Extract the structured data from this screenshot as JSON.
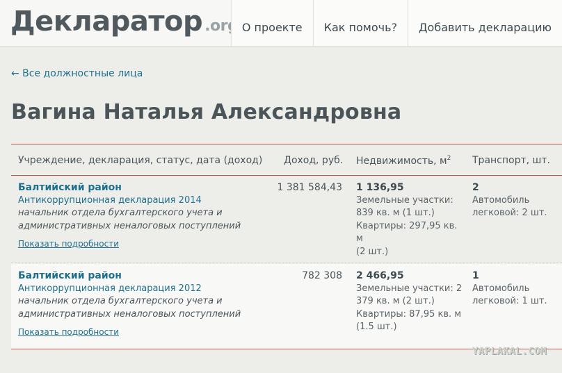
{
  "header": {
    "logo_main": "Декларатор",
    "logo_tld": ".org",
    "nav": [
      {
        "label": "О проекте"
      },
      {
        "label": "Как помочь?"
      },
      {
        "label": "Добавить декларацию"
      }
    ]
  },
  "backlink": "← Все должностные лица",
  "title": "Вагина Наталья Александровна",
  "table": {
    "headers": {
      "institution": "Учреждение, декларация, статус, дата (доход)",
      "income": "Доход, руб.",
      "property": "Недвижимость, м",
      "property_sup": "2",
      "transport": "Транспорт, шт."
    },
    "rows": [
      {
        "institution": "Балтийский район",
        "declaration": "Антикоррупционная декларация 2014",
        "status_line1": "начальник отдела бухгалтерского учета и",
        "status_line2": "административных неналоговых поступлений",
        "details": "Показать подробности",
        "income": "1 381 584,43",
        "property_total": "1 136,95",
        "property_lines": [
          "Земельные участки:",
          "839 кв. м (1 шт.)",
          "Квартиры: 297,95 кв. м",
          "(2 шт.)"
        ],
        "transport_total": "2",
        "transport_lines": [
          "Автомобиль",
          "легковой: 2 шт."
        ]
      },
      {
        "institution": "Балтийский район",
        "declaration": "Антикоррупционная декларация 2012",
        "status_line1": "начальник отдела бухгалтерского учета и",
        "status_line2": "административных неналоговых поступлений",
        "details": "Показать подробности",
        "income": "782 308",
        "property_total": "2 466,95",
        "property_lines": [
          "Земельные участки: 2",
          "379 кв. м (2 шт.)",
          "Квартиры: 87,95 кв. м",
          "(1.5 шт.)"
        ],
        "transport_total": "1",
        "transport_lines": [
          "Автомобиль",
          "легковой: 1 шт."
        ]
      }
    ]
  },
  "watermark": "YAPLAKAL.COM"
}
